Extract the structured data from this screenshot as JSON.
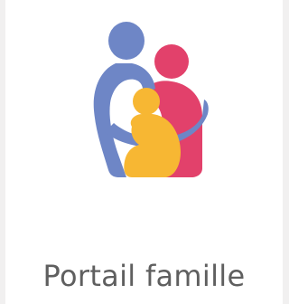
{
  "tile": {
    "label": "Portail famille",
    "icon": "family-icon",
    "colors": {
      "parent_blue": "#6e86c6",
      "parent_pink": "#e2416b",
      "child_yellow": "#f7b733",
      "label_gray": "#5f5f5f",
      "background": "#ffffff",
      "side_strip": "#f1f0f0"
    }
  }
}
